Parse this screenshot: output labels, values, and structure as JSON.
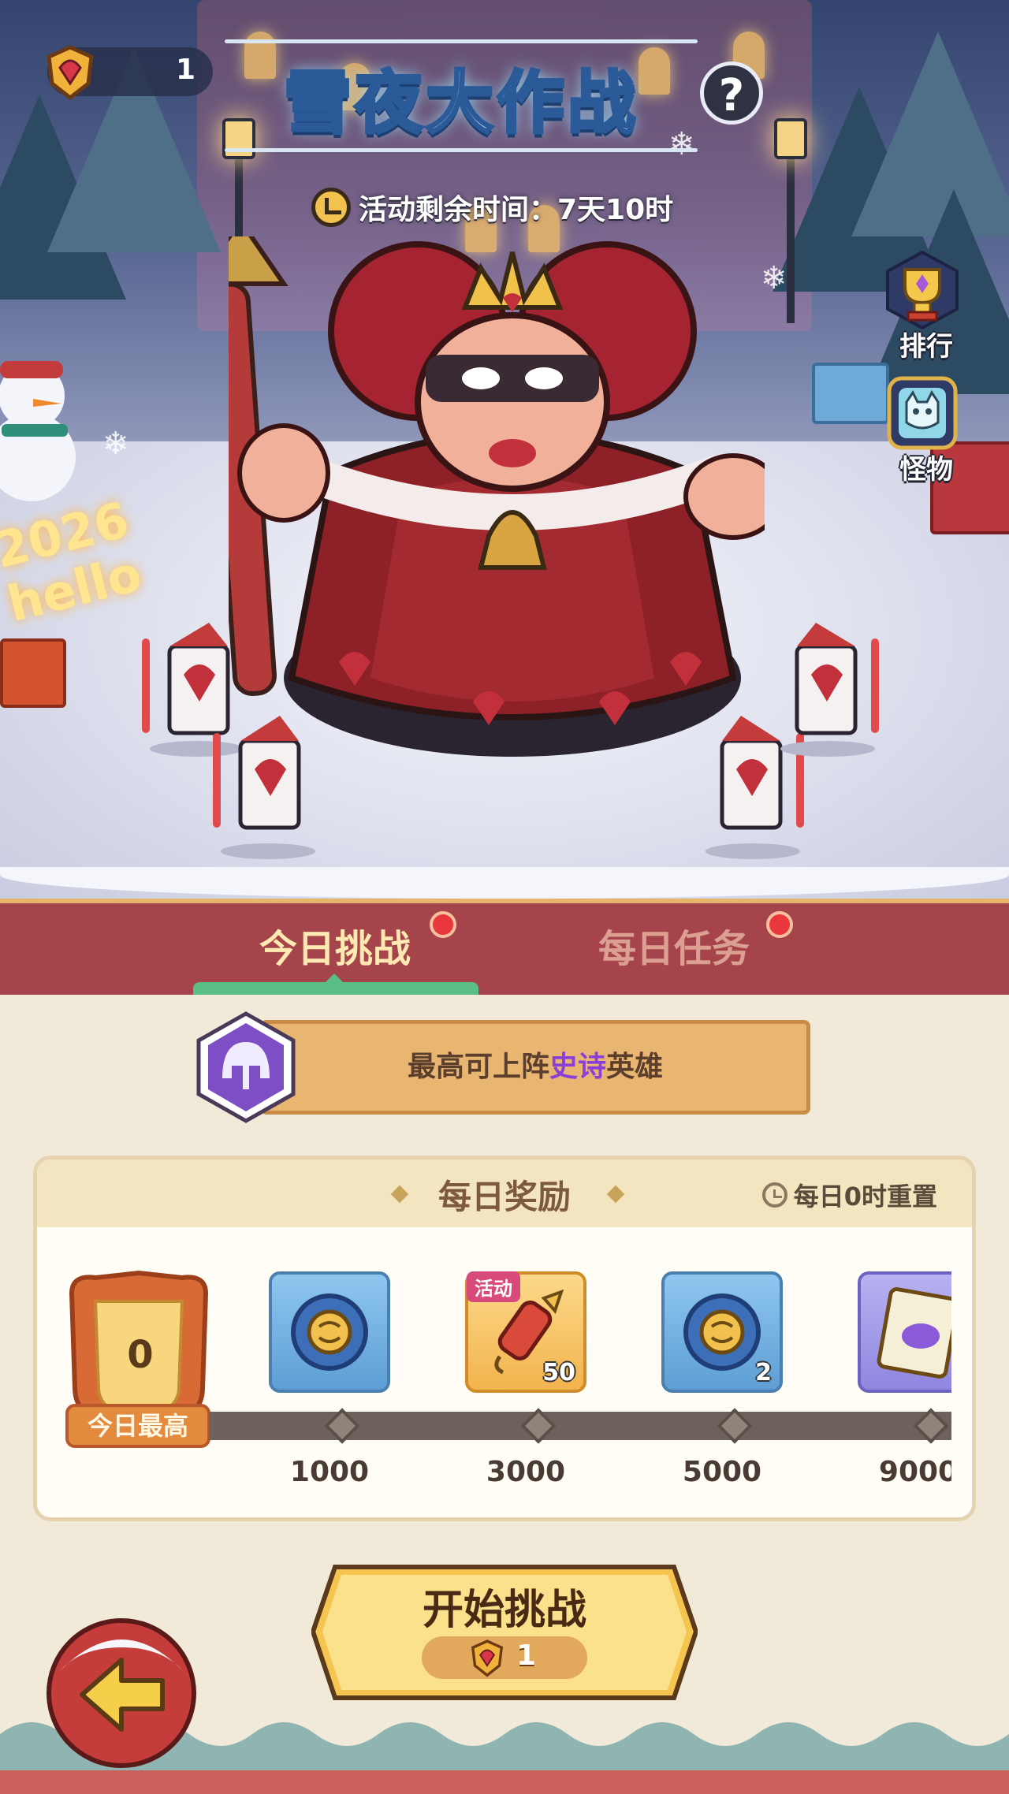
{
  "header": {
    "title": "雪夜大作战",
    "help_label": "?",
    "timer_label": "活动剩余时间：7天10时",
    "currency_count": "1",
    "currency_icon": "heart-crest-icon"
  },
  "side_buttons": [
    {
      "label": "排行",
      "icon": "trophy-icon"
    },
    {
      "label": "怪物",
      "icon": "monster-icon"
    }
  ],
  "scene": {
    "sign_text": "2026 hello"
  },
  "tabs": [
    {
      "label": "今日挑战",
      "active": true,
      "has_notification": true
    },
    {
      "label": "每日任务",
      "active": false,
      "has_notification": true
    }
  ],
  "hero_limit": {
    "prefix": "最高可上阵",
    "highlight": "史诗",
    "suffix": "英雄",
    "highlight_color": "#8a3fd8",
    "icon": "helmet-icon"
  },
  "daily_rewards": {
    "title": "每日奖励",
    "reset_text": "每日0时重置",
    "best_label": "今日最高",
    "best_value": "0",
    "milestones": [
      {
        "score": "1000",
        "item_icon": "gear-orb-icon",
        "qty": "",
        "tag": ""
      },
      {
        "score": "3000",
        "item_icon": "firework-rocket-icon",
        "qty": "50",
        "tag": "活动"
      },
      {
        "score": "5000",
        "item_icon": "gear-orb-icon",
        "qty": "2",
        "tag": ""
      },
      {
        "score": "9000",
        "item_icon": "integral-card-icon",
        "qty": "",
        "tag": ""
      }
    ]
  },
  "start_button": {
    "label": "开始挑战",
    "cost": "1",
    "cost_icon": "heart-crest-icon"
  },
  "back_button": {
    "icon": "back-arrow-icon"
  }
}
